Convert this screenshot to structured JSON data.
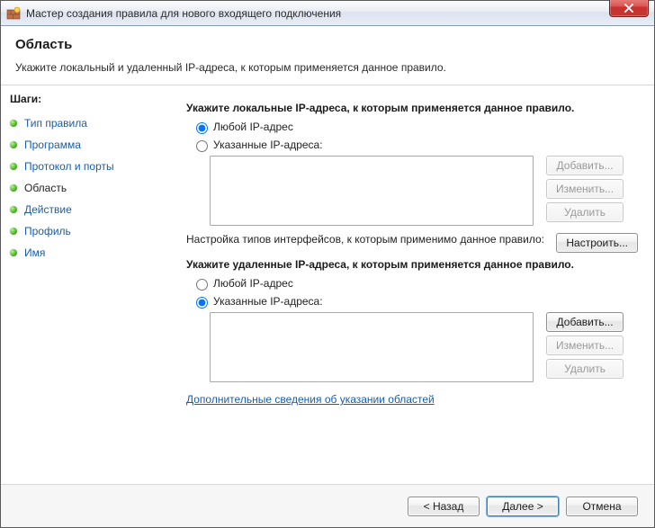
{
  "window": {
    "title": "Мастер создания правила для нового входящего подключения"
  },
  "header": {
    "heading": "Область",
    "description": "Укажите локальный и удаленный IP-адреса, к которым применяется данное правило."
  },
  "sidebar": {
    "steps_label": "Шаги:",
    "items": [
      {
        "label": "Тип правила",
        "active": false
      },
      {
        "label": "Программа",
        "active": false
      },
      {
        "label": "Протокол и порты",
        "active": false
      },
      {
        "label": "Область",
        "active": true
      },
      {
        "label": "Действие",
        "active": false
      },
      {
        "label": "Профиль",
        "active": false
      },
      {
        "label": "Имя",
        "active": false
      }
    ]
  },
  "main": {
    "local": {
      "heading": "Укажите локальные IP-адреса, к которым применяется данное правило.",
      "radio_any": "Любой IP-адрес",
      "radio_specific": "Указанные IP-адреса:",
      "selected": "any",
      "buttons": {
        "add": "Добавить...",
        "edit": "Изменить...",
        "remove": "Удалить"
      }
    },
    "interface": {
      "text": "Настройка типов интерфейсов, к которым применимо данное правило:",
      "button": "Настроить..."
    },
    "remote": {
      "heading": "Укажите удаленные IP-адреса, к которым применяется данное правило.",
      "radio_any": "Любой IP-адрес",
      "radio_specific": "Указанные IP-адреса:",
      "selected": "specific",
      "buttons": {
        "add": "Добавить...",
        "edit": "Изменить...",
        "remove": "Удалить"
      }
    },
    "help_link": "Дополнительные сведения об указании областей"
  },
  "footer": {
    "back": "< Назад",
    "next": "Далее >",
    "cancel": "Отмена"
  }
}
